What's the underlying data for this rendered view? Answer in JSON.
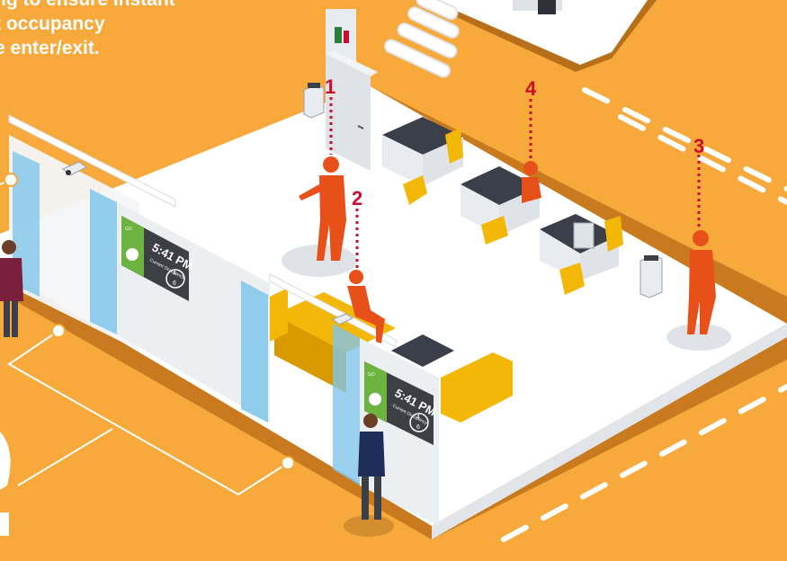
{
  "caption": {
    "lines": [
      "ng to ensure instant",
      "t occupancy",
      "e enter/exit."
    ]
  },
  "markers": [
    "1",
    "2",
    "3",
    "4"
  ],
  "screens": [
    {
      "time": "5:41 PM",
      "count_top": "4",
      "count_bottom": "6",
      "status": "GO",
      "subtitle": "Current Occupancy"
    },
    {
      "time": "5:41 PM",
      "count_top": "4",
      "count_bottom": "6",
      "status": "GO",
      "subtitle": "Current Occupancy"
    }
  ],
  "colors": {
    "background": "#f7a93c",
    "floor": "#ffffff",
    "floor_edge": "#c97a1f",
    "person_highlight": "#e8501a",
    "marker_red": "#c8102e",
    "desk_dark": "#3b3f4a",
    "chair_yellow": "#f2b707",
    "screen_green": "#6db33f",
    "screen_dark": "#3d3f45",
    "glass_blue": "#7fc6ea"
  }
}
